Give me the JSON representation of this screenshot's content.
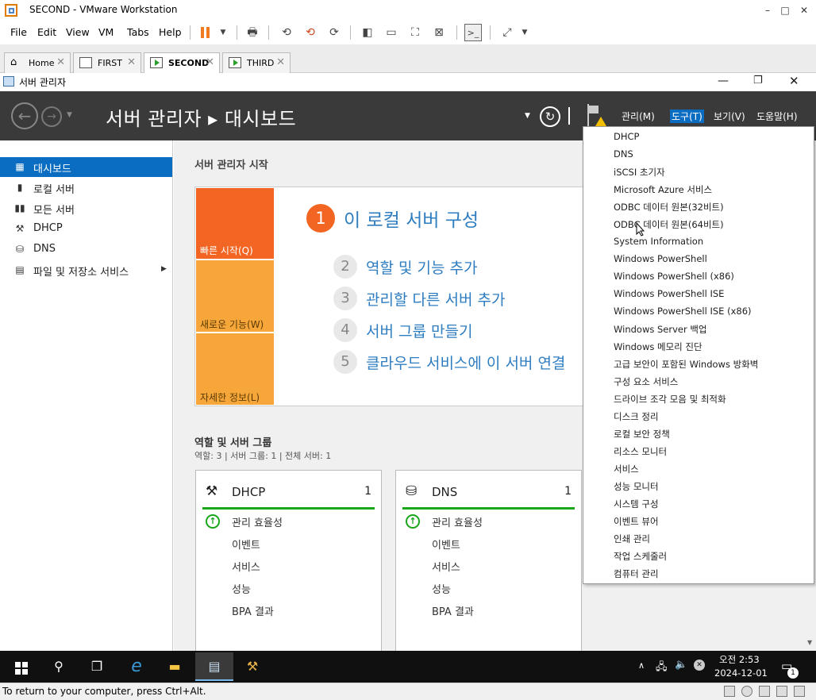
{
  "window": {
    "title": "SECOND - VMware Workstation",
    "minimize": "–",
    "maximize": "□",
    "close": "✕"
  },
  "menubar": {
    "items": [
      "File",
      "Edit",
      "View",
      "VM",
      "Tabs",
      "Help"
    ]
  },
  "tabs": [
    {
      "label": "Home",
      "icon": "home-icon",
      "active": false
    },
    {
      "label": "FIRST",
      "icon": "vm-icon",
      "active": false
    },
    {
      "label": "SECOND",
      "icon": "vm-running-icon",
      "active": true
    },
    {
      "label": "THIRD",
      "icon": "vm-running-icon",
      "active": false
    }
  ],
  "server_manager": {
    "window_title": "서버 관리자",
    "header_title": "서버 관리자 ▸ 대시보드",
    "header_menus": [
      "관리(M)",
      "도구(T)",
      "보기(V)",
      "도움말(H)"
    ],
    "active_menu": "도구(T)"
  },
  "sidebar": {
    "items": [
      {
        "label": "대시보드",
        "selected": true,
        "icon": "dashboard-icon"
      },
      {
        "label": "로컬 서버",
        "selected": false,
        "icon": "local-server-icon"
      },
      {
        "label": "모든 서버",
        "selected": false,
        "icon": "all-servers-icon"
      },
      {
        "label": "DHCP",
        "selected": false,
        "icon": "dhcp-icon"
      },
      {
        "label": "DNS",
        "selected": false,
        "icon": "dns-icon"
      },
      {
        "label": "파일 및 저장소 서비스",
        "selected": false,
        "icon": "file-storage-icon"
      }
    ],
    "expand_arrow": "▶"
  },
  "quick_start": {
    "section_title": "서버 관리자 시작",
    "tiles": [
      "빠른 시작(Q)",
      "새로운 기능(W)",
      "자세한 정보(L)"
    ],
    "main_step": {
      "num": "1",
      "label": "이 로컬 서버 구성"
    },
    "steps": [
      {
        "num": "2",
        "label": "역할 및 기능 추가"
      },
      {
        "num": "3",
        "label": "관리할 다른 서버 추가"
      },
      {
        "num": "4",
        "label": "서버 그룹 만들기"
      },
      {
        "num": "5",
        "label": "클라우드 서비스에 이 서버 연결"
      }
    ]
  },
  "roles": {
    "title": "역할 및 서버 그룹",
    "subtitle": "역할: 3   |   서버 그룹: 1   |   전체 서버: 1",
    "cards": [
      {
        "name": "DHCP",
        "count": "1",
        "items": [
          "관리 효율성",
          "이벤트",
          "서비스",
          "성능",
          "BPA 결과"
        ]
      },
      {
        "name": "DNS",
        "count": "1",
        "items": [
          "관리 효율성",
          "이벤트",
          "서비스",
          "성능",
          "BPA 결과"
        ]
      }
    ]
  },
  "tools_menu": {
    "items": [
      "DHCP",
      "DNS",
      "iSCSI 초기자",
      "Microsoft Azure 서비스",
      "ODBC 데이터 원본(32비트)",
      "ODBC 데이터 원본(64비트)",
      "System Information",
      "Windows PowerShell",
      "Windows PowerShell (x86)",
      "Windows PowerShell ISE",
      "Windows PowerShell ISE (x86)",
      "Windows Server 백업",
      "Windows 메모리 진단",
      "고급 보안이 포함된 Windows 방화벽",
      "구성 요소 서비스",
      "드라이브 조각 모음 및 최적화",
      "디스크 정리",
      "로컬 보안 정책",
      "리소스 모니터",
      "서비스",
      "성능 모니터",
      "시스템 구성",
      "이벤트 뷰어",
      "인쇄 관리",
      "작업 스케줄러",
      "컴퓨터 관리"
    ]
  },
  "taskbar": {
    "time": "오전 2:53",
    "date": "2024-12-01",
    "notification_count": "1"
  },
  "statusbar": {
    "text": "To return to your computer, press Ctrl+Alt."
  },
  "colors": {
    "accent": "#0a6dc2",
    "header_bg": "#3a3a3a",
    "tile_orange": "#f26522",
    "tile_yellow": "#f7a73a",
    "status_green": "#19a619",
    "link_blue": "#2e7dc1"
  }
}
